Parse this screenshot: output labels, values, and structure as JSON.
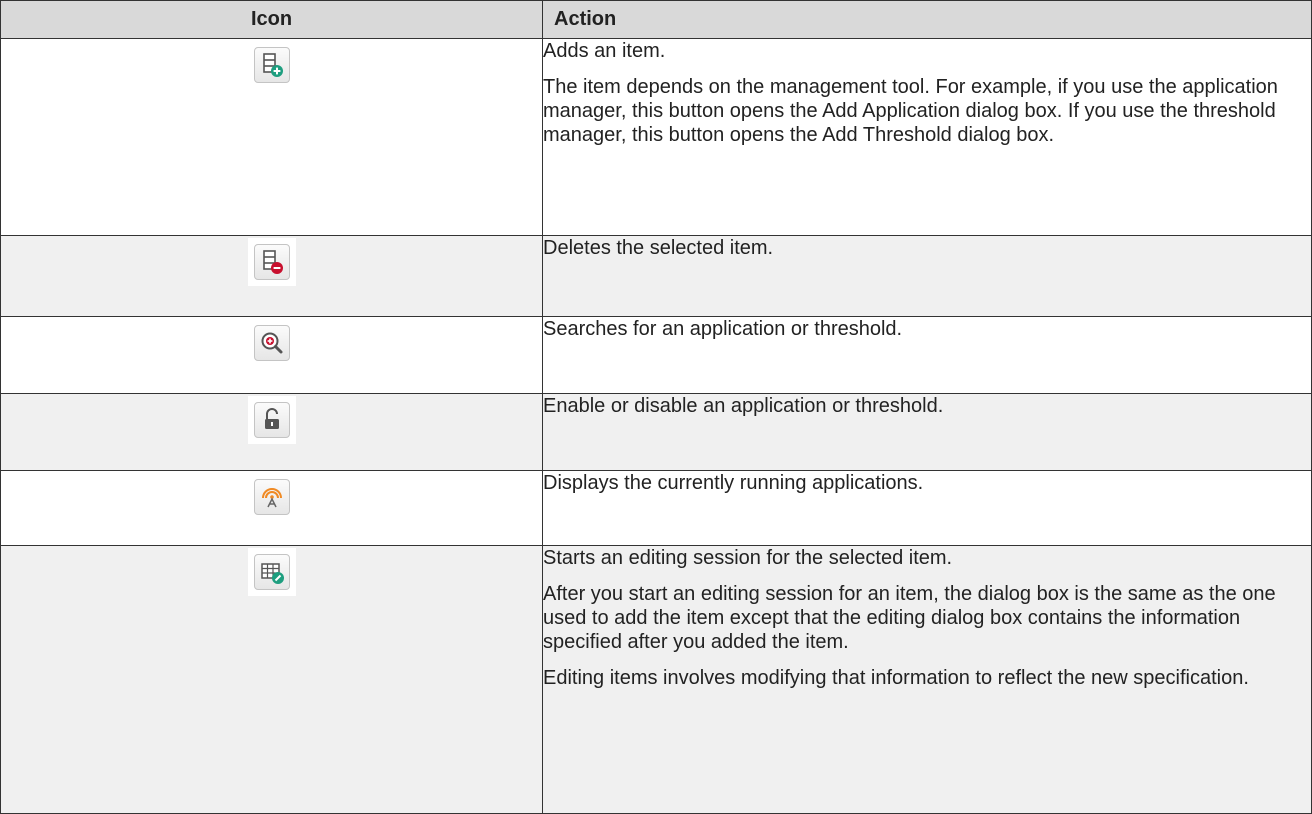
{
  "table": {
    "headers": {
      "icon": "Icon",
      "action": "Action"
    },
    "rows": [
      {
        "icon": "add-item-icon",
        "paragraphs": [
          "Adds an item.",
          "The item depends on the management tool. For example, if you use the application manager, this button opens the Add Application dialog box. If you use the threshold manager, this button opens the Add Threshold dialog box."
        ]
      },
      {
        "icon": "delete-item-icon",
        "paragraphs": [
          "Deletes the selected item."
        ]
      },
      {
        "icon": "search-icon",
        "paragraphs": [
          "Searches for an application or threshold."
        ]
      },
      {
        "icon": "unlock-icon",
        "paragraphs": [
          "Enable or disable an application or threshold."
        ]
      },
      {
        "icon": "running-applications-icon",
        "paragraphs": [
          "Displays the currently running applications."
        ]
      },
      {
        "icon": "edit-item-icon",
        "paragraphs": [
          "Starts an editing session for the selected item.",
          "After you start an editing session for an item, the dialog box is the same as the one used to add the item except that the editing dialog box contains the information specified after you added the item.",
          "Editing items involves modifying that information to reflect the new specification."
        ]
      }
    ]
  },
  "colors": {
    "header_bg": "#d9d9d9",
    "shaded_row_bg": "#f0f0f0",
    "border": "#333333",
    "add_accent": "#1e9e7f",
    "delete_accent": "#c8102e",
    "running_accent": "#f08a24"
  }
}
